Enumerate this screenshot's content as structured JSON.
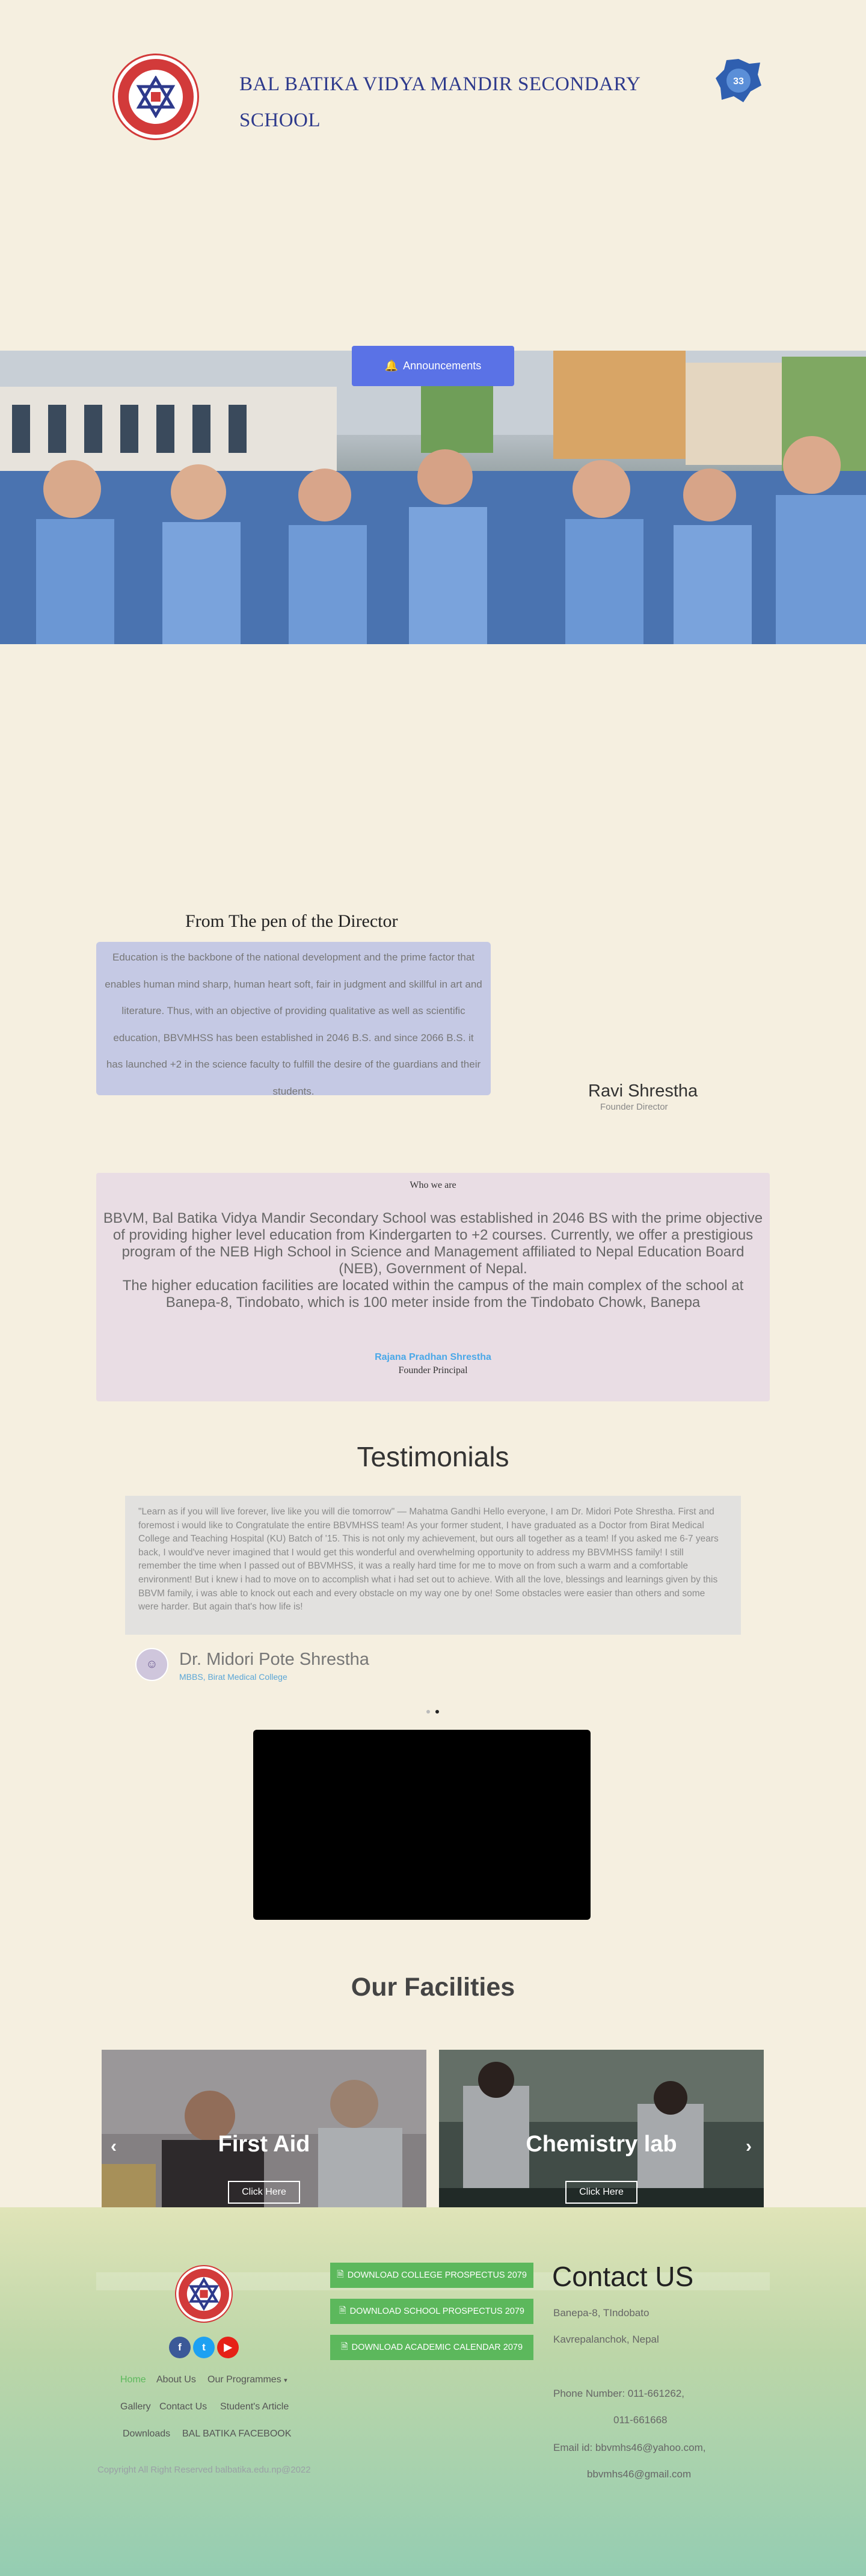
{
  "header": {
    "school_name": "BAL BATIKA VIDYA MANDIR SECONDARY SCHOOL"
  },
  "hero": {
    "announcement_label": "Announcements"
  },
  "director": {
    "heading": "From The pen of the Director",
    "message": "Education is the backbone of the national development and the prime factor that enables human mind sharp, human heart soft, fair in judgment and skillful in art and literature. Thus, with an objective of providing qualitative as well as scientific education, BBVMHSS has been established in 2046 B.S. and since 2066 B.S. it has launched +2 in the science faculty to fulfill the desire of the guardians and their students.",
    "name": "Ravi Shrestha",
    "title": "Founder Director"
  },
  "about": {
    "label": "Who we are",
    "paragraph1": "BBVM, Bal Batika Vidya Mandir Secondary School was established in 2046 BS with the prime objective of providing higher level education from Kindergarten to +2 courses. Currently, we offer a prestigious program of the NEB High School in Science and Management affiliated to Nepal Education Board (NEB), Government of Nepal.",
    "paragraph2": "The higher education facilities are located within the campus of the main complex of the school at Banepa-8, Tindobato, which is 100 meter inside from the Tindobato Chowk, Banepa",
    "principal_name": "Rajana Pradhan Shrestha",
    "principal_role": "Founder Principal"
  },
  "testimonials": {
    "heading": "Testimonials",
    "quote": "\"Learn as if you will live forever, live like you will die tomorrow\" — Mahatma Gandhi Hello everyone, I am Dr. Midori Pote Shrestha. First and foremost i would like to Congratulate the entire BBVMHSS team! As your former student, I have graduated as a Doctor from Birat Medical College and Teaching Hospital (KU) Batch of '15. This is not only my achievement, but ours all together as a team! If you asked me 6-7 years back, I would've never imagined that I would get this wonderful and overwhelming opportunity to address my BBVMHSS family! I still remember the time when I passed out of BBVMHSS, it was a really hard time for me to move on from such a warm and a comfortable environment! But i knew i had to move on to accomplish what i had set out to achieve. With all the love, blessings and learnings given by this BBVM family, i was able to knock out each and every obstacle on my way one by one! Some obstacles were easier than others and some were harder. But again that's how life is!",
    "author_name": "Dr. Midori Pote Shrestha",
    "author_role": "MBBS, Birat Medical College"
  },
  "facilities": {
    "heading": "Our Facilities",
    "cards": [
      {
        "title": "First Aid",
        "button": "Click Here"
      },
      {
        "title": "Chemistry lab",
        "button": "Click Here"
      }
    ]
  },
  "footer": {
    "social": [
      {
        "icon": "facebook-icon",
        "glyph": "f",
        "color": "#3b5998"
      },
      {
        "icon": "twitter-icon",
        "glyph": "t",
        "color": "#1da1f2"
      },
      {
        "icon": "youtube-icon",
        "glyph": "▶",
        "color": "#e62117"
      }
    ],
    "nav": {
      "home": "Home",
      "about": "About Us",
      "programmes": "Our Programmes",
      "gallery": "Gallery",
      "contact": "Contact Us",
      "articles": "Student's Article",
      "downloads": "Downloads",
      "facebook": "BAL BATIKA FACEBOOK"
    },
    "downloads": [
      "DOWNLOAD COLLEGE PROSPECTUS 2079",
      "DOWNLOAD SCHOOL PROSPECTUS 2079",
      "DOWNLOAD ACADEMIC CALENDAR 2079"
    ],
    "contact": {
      "title": "Contact US",
      "address1": "Banepa-8, TIndobato",
      "address2": "Kavrepalanchok, Nepal",
      "phone_label": "Phone Number: 011-661262,",
      "phone2": "011-661668",
      "email_label": "Email id: bbvmhs46@yahoo.com,",
      "email2": "bbvmhs46@gmail.com"
    },
    "copyright": "Copyright All Right Reserved balbatika.edu.np@2022"
  },
  "colors": {
    "background": "#f5efe0",
    "brand_blue": "#2e3a8c",
    "announcement": "#5a72e6",
    "download_green": "#5cb85c",
    "link_blue": "#4aa8e8"
  }
}
